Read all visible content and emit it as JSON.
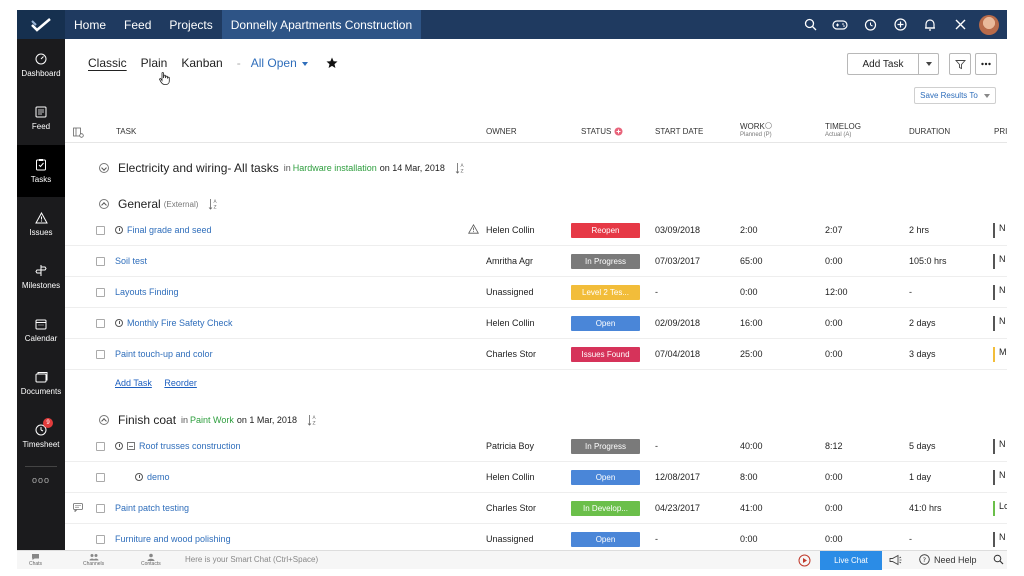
{
  "topnav": {
    "items": [
      "Home",
      "Feed",
      "Projects"
    ],
    "project": "Donnelly Apartments Construction"
  },
  "sidebar": {
    "items": [
      "Dashboard",
      "Feed",
      "Tasks",
      "Issues",
      "Milestones",
      "Calendar",
      "Documents",
      "Timesheet"
    ],
    "timesheet_badge": "9",
    "more": "ooo"
  },
  "views": {
    "tabs": [
      "Classic",
      "Plain",
      "Kanban"
    ],
    "separator": "-",
    "filter": "All Open"
  },
  "toolbar": {
    "add_task": "Add Task",
    "save_results": "Save Results To"
  },
  "columns": {
    "task": "TASK",
    "owner": "OWNER",
    "status": "STATUS",
    "start_date": "START DATE",
    "work": "WORK",
    "work_sub": "Planned (P)",
    "timelog": "TIMELOG",
    "timelog_sub": "Actual (A)",
    "duration": "DURATION",
    "priority": "PRI"
  },
  "groups": {
    "electric": {
      "title": "Electricity and wiring- All tasks",
      "in": "in",
      "list": "Hardware installation",
      "on": "on 14 Mar, 2018"
    },
    "general": {
      "title": "General",
      "sub": "(External)"
    },
    "finish": {
      "title": "Finish coat",
      "in": "in",
      "list": "Paint Work",
      "on": "on 1 Mar, 2018"
    }
  },
  "general_rows": [
    {
      "name": "Final grade and seed",
      "owner": "Helen Collin",
      "status": "Reopen",
      "start": "03/09/2018",
      "work": "2:00",
      "timelog": "2:07",
      "duration": "2 hrs",
      "pri": "N"
    },
    {
      "name": "Soil test",
      "owner": "Amritha Agr",
      "status": "In Progress",
      "start": "07/03/2017",
      "work": "65:00",
      "timelog": "0:00",
      "duration": "105:0 hrs",
      "pri": "N"
    },
    {
      "name": "Layouts Finding",
      "owner": "Unassigned",
      "status": "Level 2 Tes...",
      "start": "-",
      "work": "0:00",
      "timelog": "12:00",
      "duration": "-",
      "pri": "N"
    },
    {
      "name": "Monthly Fire Safety Check",
      "owner": "Helen Collin",
      "status": "Open",
      "start": "02/09/2018",
      "work": "16:00",
      "timelog": "0:00",
      "duration": "2 days",
      "pri": "N"
    },
    {
      "name": "Paint touch-up and color",
      "owner": "Charles Stor",
      "status": "Issues Found",
      "start": "07/04/2018",
      "work": "25:00",
      "timelog": "0:00",
      "duration": "3 days",
      "pri": "M"
    }
  ],
  "general_links": {
    "add_task": "Add Task",
    "reorder": "Reorder"
  },
  "finish_rows": [
    {
      "name": "Roof trusses construction",
      "owner": "Patricia Boy",
      "status": "In Progress",
      "start": "-",
      "work": "40:00",
      "timelog": "8:12",
      "duration": "5 days",
      "pri": "N"
    },
    {
      "name": "demo",
      "owner": "Helen Collin",
      "status": "Open",
      "start": "12/08/2017",
      "work": "8:00",
      "timelog": "0:00",
      "duration": "1 day",
      "pri": "N"
    },
    {
      "name": "Paint patch testing",
      "owner": "Charles Stor",
      "status": "In Develop...",
      "start": "04/23/2017",
      "work": "41:00",
      "timelog": "0:00",
      "duration": "41:0 hrs",
      "pri": "Lc"
    },
    {
      "name": "Furniture and wood polishing",
      "owner": "Unassigned",
      "status": "Open",
      "start": "-",
      "work": "0:00",
      "timelog": "0:00",
      "duration": "-",
      "pri": "N"
    }
  ],
  "colors": {
    "reopen": "#e63946",
    "in_progress": "#7a7a7a",
    "level2": "#f2bd3a",
    "open": "#4a86d8",
    "issues_found": "#d6335a",
    "in_develop": "#6bbf4a"
  },
  "bottombar": {
    "chats": "Chats",
    "channels": "Channels",
    "contacts": "Contacts",
    "smart_chat": "Here is your Smart Chat (Ctrl+Space)",
    "live_chat": "Live Chat",
    "need_help": "Need Help"
  }
}
